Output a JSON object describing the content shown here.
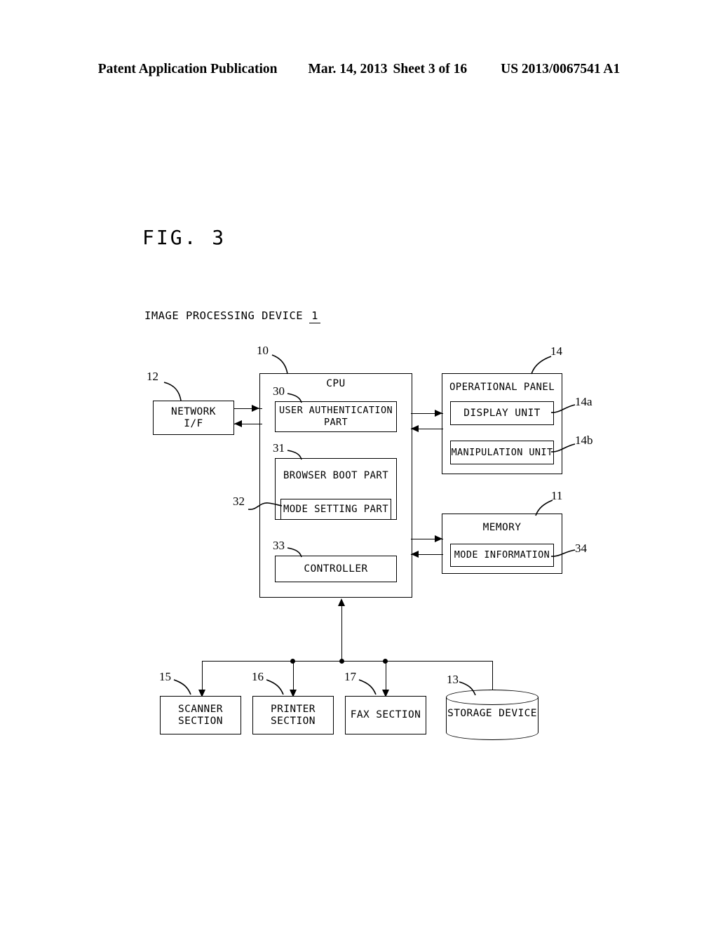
{
  "header": {
    "publication": "Patent Application Publication",
    "date": "Mar. 14, 2013",
    "sheet": "Sheet 3 of 16",
    "patent_number": "US 2013/0067541 A1"
  },
  "figure": {
    "title": "FIG. 3",
    "caption": "IMAGE PROCESSING DEVICE",
    "caption_ref": "1"
  },
  "blocks": {
    "network_if": {
      "label": "NETWORK\nI/F",
      "ref": "12"
    },
    "cpu": {
      "label": "CPU",
      "ref": "10"
    },
    "user_auth": {
      "label": "USER AUTHENTICATION\nPART",
      "ref": "30"
    },
    "browser_boot": {
      "label": "BROWSER BOOT PART",
      "ref": "31"
    },
    "mode_setting": {
      "label": "MODE SETTING PART",
      "ref": "32"
    },
    "controller": {
      "label": "CONTROLLER",
      "ref": "33"
    },
    "operational_panel": {
      "label": "OPERATIONAL PANEL",
      "ref": "14"
    },
    "display_unit": {
      "label": "DISPLAY UNIT",
      "ref": "14a"
    },
    "manipulation_unit": {
      "label": "MANIPULATION UNIT",
      "ref": "14b"
    },
    "memory": {
      "label": "MEMORY",
      "ref": "11"
    },
    "mode_information": {
      "label": "MODE INFORMATION",
      "ref": "34"
    },
    "scanner_section": {
      "label": "SCANNER\nSECTION",
      "ref": "15"
    },
    "printer_section": {
      "label": "PRINTER\nSECTION",
      "ref": "16"
    },
    "fax_section": {
      "label": "FAX SECTION",
      "ref": "17"
    },
    "storage_device": {
      "label": "STORAGE DEVICE",
      "ref": "13"
    }
  },
  "colors": {
    "ink": "#000000",
    "paper": "#ffffff"
  }
}
